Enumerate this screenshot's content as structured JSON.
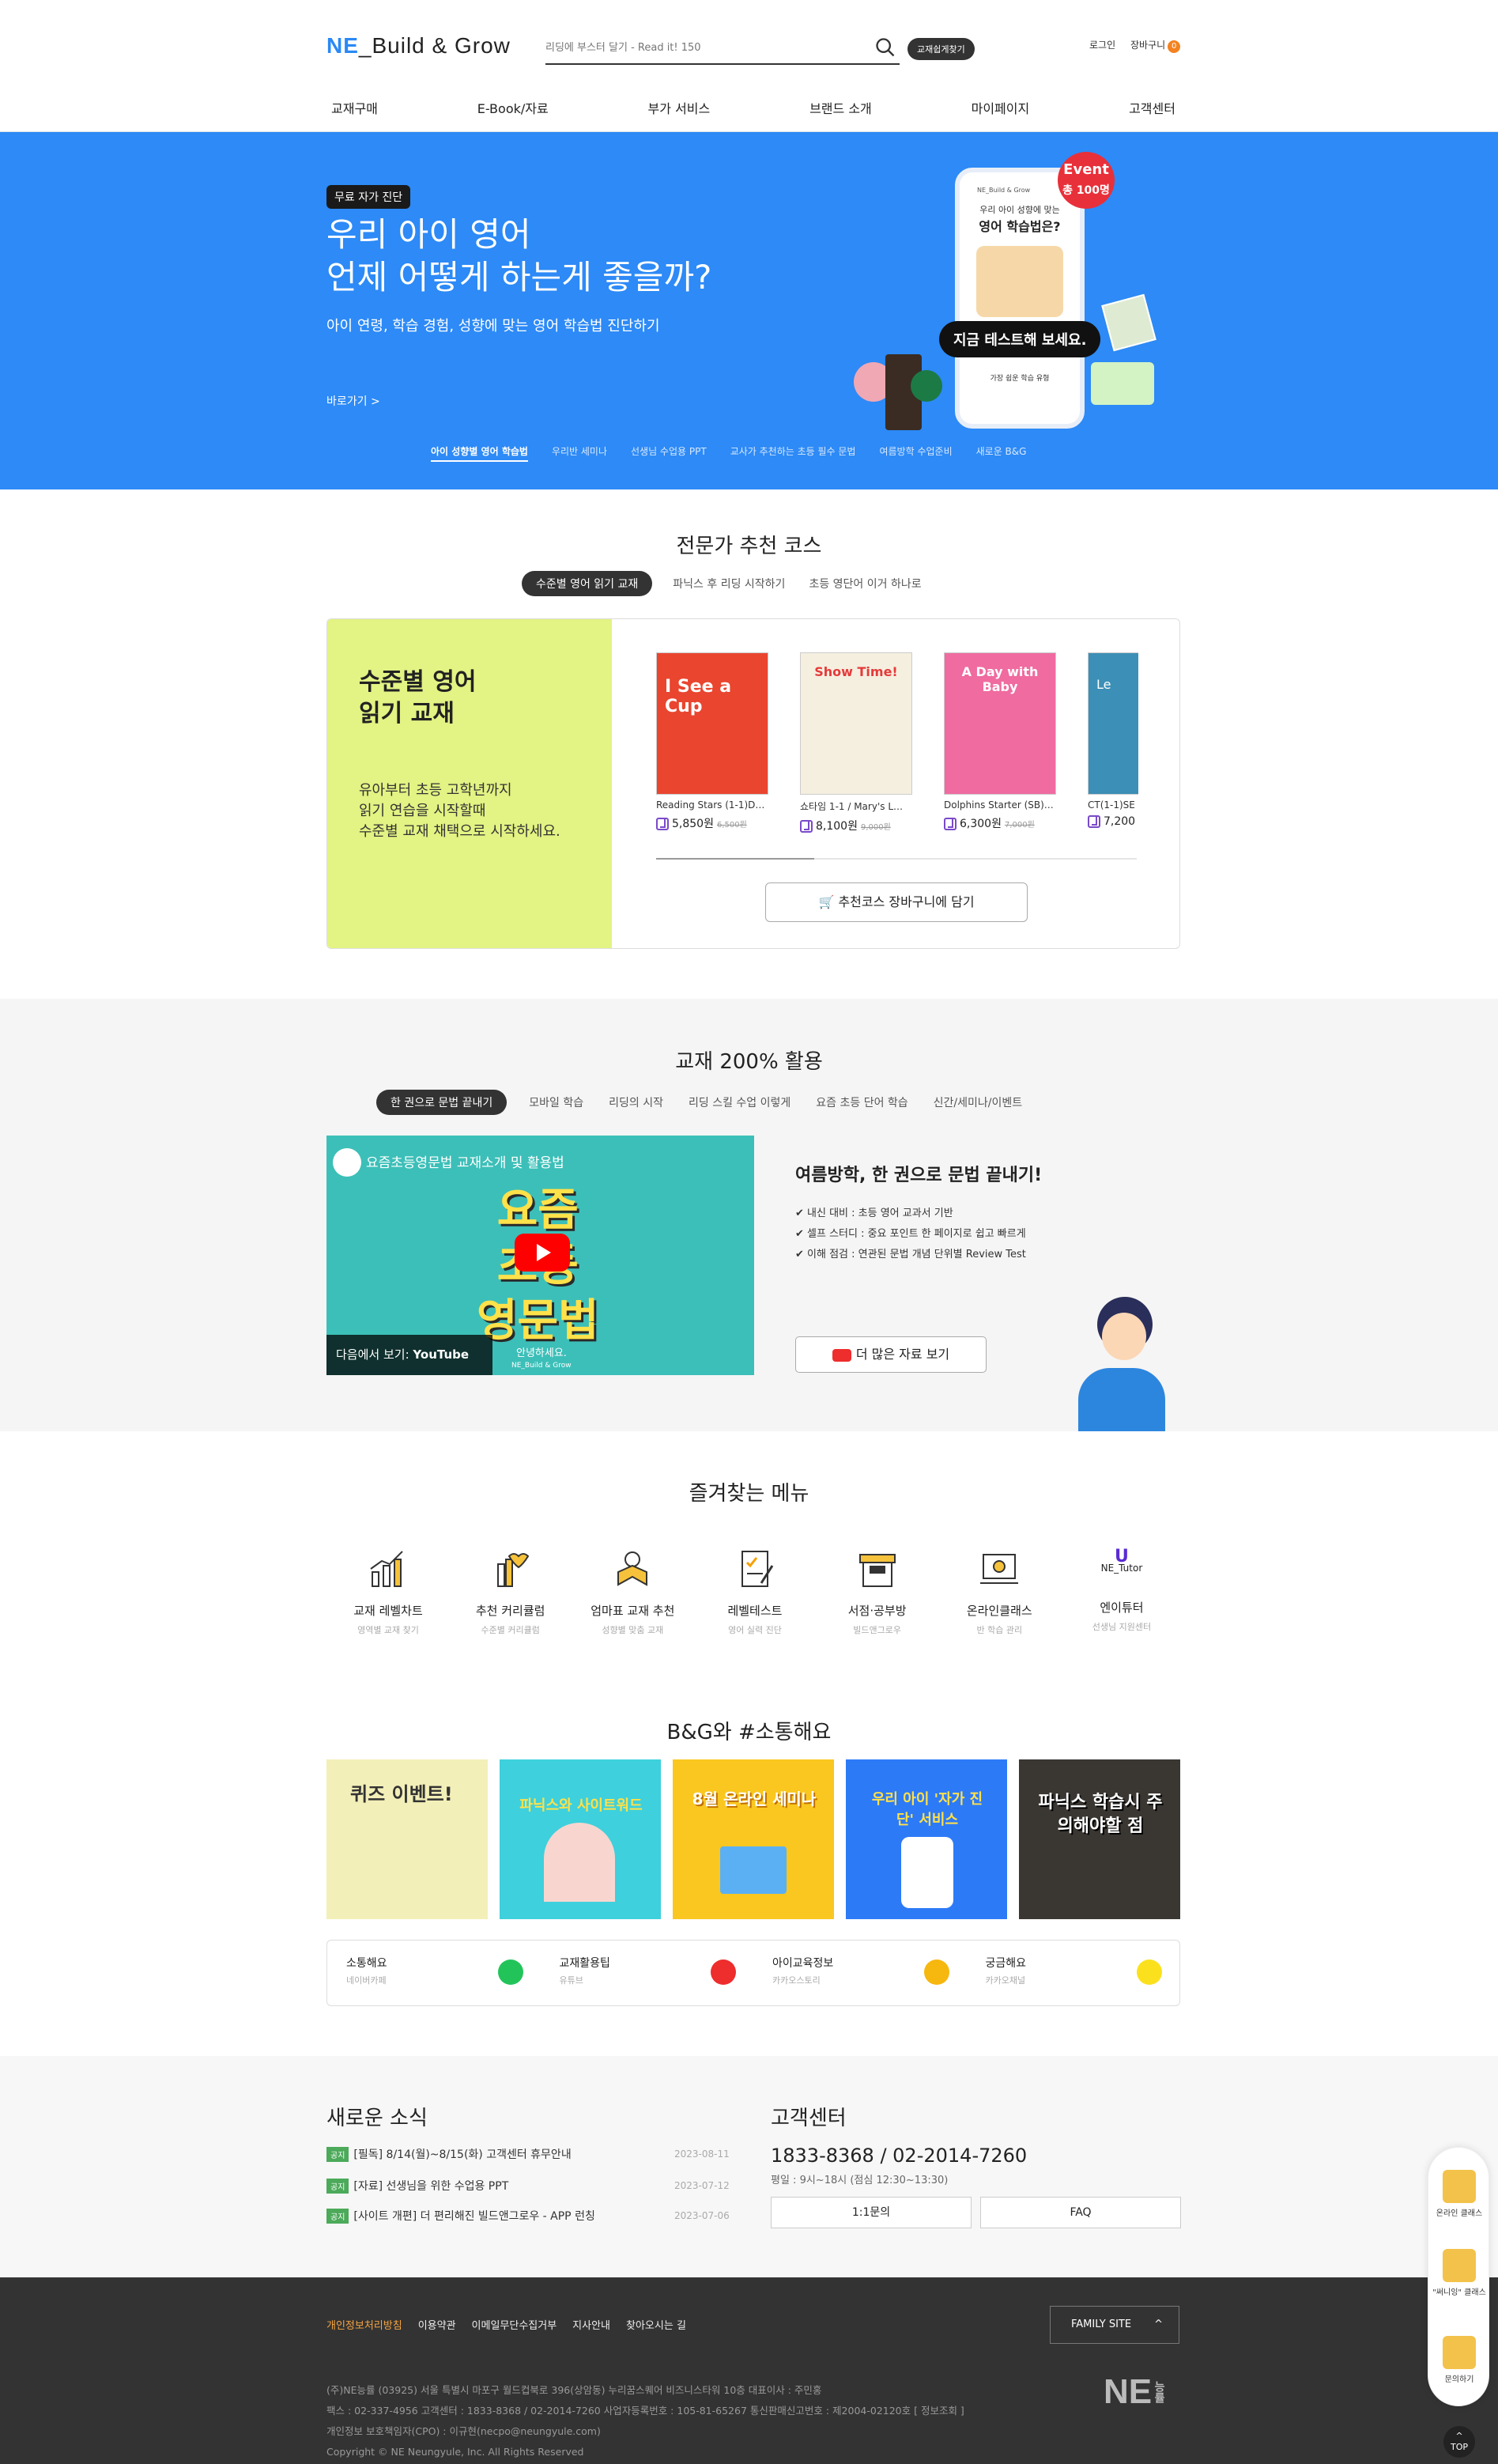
{
  "header": {
    "logo_ne": "NE",
    "logo_rest": "_Build & Grow",
    "search_placeholder": "리딩에 부스터 달기 - Read it! 150",
    "find_book": "교재쉽게찾기",
    "login": "로그인",
    "cart": "장바구니",
    "cart_count": "0",
    "gnb": [
      "교재구매",
      "E-Book/자료",
      "부가 서비스",
      "브랜드 소개",
      "마이페이지",
      "고객센터"
    ]
  },
  "hero": {
    "tag": "무료 자가 진단",
    "title1": "우리 아이 영어",
    "title2": "언제 어떻게 하는게 좋을까?",
    "sub": "아이 연령, 학습 경험, 성향에 맞는 영어 학습법 진단하기",
    "go": "바로가기  >",
    "phone_brand": "NE_Build & Grow",
    "phone_q1": "우리 아이 성향에 맞는",
    "phone_q2": "영어 학습법은?",
    "event1": "Event",
    "event2": "총 100명",
    "cta": "지금 테스트해 보세요.",
    "phone_opt": "가장 쉽운 학습 유형",
    "tabs": [
      "아이 성향별 영어 학습법",
      "우리반 세미나",
      "선생님 수업용 PPT",
      "교사가 추천하는 초등 필수 문법",
      "여름방학 수업준비",
      "새로운 B&G"
    ]
  },
  "expert": {
    "title": "전문가 추천 코스",
    "tabs": [
      "수준별 영어 읽기 교재",
      "파닉스 후 리딩 시작하기",
      "초등 영단어 이거 하나로"
    ],
    "course_title1": "수준별 영어",
    "course_title2": "읽기 교재",
    "course_desc1": "유아부터 초등 고학년까지",
    "course_desc2": "읽기 연습을 시작할때",
    "course_desc3": "수준별 교재 채택으로 시작하세요.",
    "books": [
      {
        "name": "Reading Stars (1-1)D…",
        "price": "5,850원",
        "orig": "6,500원",
        "cover": "I See a Cup",
        "color": "#e9452f"
      },
      {
        "name": "쇼타임 1-1 / Mary's L…",
        "price": "8,100원",
        "orig": "9,000원",
        "cover": "Show Time!",
        "color": "#e53a3a"
      },
      {
        "name": "Dolphins Starter (SB)…",
        "price": "6,300원",
        "orig": "7,000원",
        "cover": "A Day with Baby",
        "color": "#ef6ba0"
      },
      {
        "name": "CT(1-1)SE",
        "price": "7,200",
        "orig": "",
        "cover": "Le",
        "color": "#3c8fb6"
      }
    ],
    "cart_btn": "추천코스 장바구니에 담기"
  },
  "usage": {
    "title": "교재 200% 활용",
    "tabs": [
      "한 권으로 문법 끝내기",
      "모바일 학습",
      "리딩의 시작",
      "리딩 스킬 수업 이렇게",
      "요즘 초등 단어 학습",
      "신간/세미나/이벤트"
    ],
    "video_title": "요즘초등영문법 교재소개 및 활용법",
    "video_big1": "요즘",
    "video_big2": "초등",
    "video_big3": "영문법",
    "video_next": "다음에서 보기:",
    "video_yt": "YouTube",
    "video_hello": "안녕하세요.",
    "video_brand": "NE_Build & Grow",
    "heading": "여름방학, 한 권으로 문법 끝내기!",
    "points": [
      "✔ 내신 대비 : 초등 영어 교과서 기반",
      "✔ 셀프 스터디 : 중요 포인트 한 페이지로 쉽고 빠르게",
      "✔ 이해 점검 : 연관된 문법 개념 단위별 Review Test"
    ],
    "more": "더 많은 자료 보기"
  },
  "favorites": {
    "title": "즐겨찾는 메뉴",
    "items": [
      {
        "label": "교재 레벨차트",
        "sub": "영역별 교재 찾기",
        "icon": "chart-icon"
      },
      {
        "label": "추천 커리큘럼",
        "sub": "수준별 커리큘럼",
        "icon": "curriculum-icon"
      },
      {
        "label": "엄마표 교재 추천",
        "sub": "성향별 맞춤 교재",
        "icon": "reading-mom-icon"
      },
      {
        "label": "레벨테스트",
        "sub": "영어 실력 진단",
        "icon": "test-icon"
      },
      {
        "label": "서점·공부방",
        "sub": "빌드앤그로우",
        "icon": "store-icon"
      },
      {
        "label": "온라인클래스",
        "sub": "반 학습 관리",
        "icon": "online-class-icon"
      },
      {
        "label": "엔이튜터",
        "sub": "선생님 지원센터",
        "icon": "ne-tutor-icon"
      }
    ],
    "ne_tutor_logo": "NE_Tutor"
  },
  "sns": {
    "title": "B&G와 #소통해요",
    "cards": [
      {
        "text": "퀴즈 이벤트!",
        "bg": "#f3efb8"
      },
      {
        "text": "파닉스와 사이트워드",
        "bg": "#3ed0dc"
      },
      {
        "text": "8월 온라인 세미나",
        "bg": "#f9c720"
      },
      {
        "text": "우리 아이 '자가 진단' 서비스",
        "bg": "#2d7af6"
      },
      {
        "text": "파닉스 학습시 주의해야할 점",
        "bg": "#3a3632"
      }
    ],
    "channels": [
      {
        "title": "소통해요",
        "sub": "네이버카페",
        "color": "#22c45a"
      },
      {
        "title": "교재활용팁",
        "sub": "유튜브",
        "color": "#ee2d2d"
      },
      {
        "title": "아이교육정보",
        "sub": "카카오스토리",
        "color": "#f6b70f"
      },
      {
        "title": "궁금해요",
        "sub": "카카오채널",
        "color": "#fbe11d"
      }
    ]
  },
  "news": {
    "title": "새로운 소식",
    "badge": "공지",
    "items": [
      {
        "text": "[필독] 8/14(월)~8/15(화) 고객센터 휴무안내",
        "date": "2023-08-11"
      },
      {
        "text": "[자료] 선생님을 위한 수업용 PPT",
        "date": "2023-07-12"
      },
      {
        "text": "[사이트 개편] 더 편리해진 빌드앤그로우 - APP 런칭",
        "date": "2023-07-06"
      }
    ]
  },
  "cs": {
    "title": "고객센터",
    "tel": "1833-8368 / 02-2014-7260",
    "hours": "평일 : 9시~18시 (점심 12:30~13:30)",
    "btn1": "1:1문의",
    "btn2": "FAQ"
  },
  "footer": {
    "links": [
      "개인정보처리방침",
      "이용약관",
      "이메일무단수집거부",
      "지사안내",
      "찾아오시는 길"
    ],
    "family": "FAMILY SITE",
    "line1": "(주)NE능률 (03925) 서울 특별시 마포구 월드컵북로 396(상암동) 누리꿈스퀘어 비즈니스타워 10층    대표이사 : 주민홍",
    "line2": "팩스 : 02-337-4956    고객센터 : 1833-8368 / 02-2014-7260    사업자등록번호 : 105-81-65267    통신판매신고번호 : 제2004-02120호 [ 정보조회 ]",
    "line3": "개인정보 보호책임자(CPO) : 이규현(necpo@neungyule.com)",
    "copy": "Copyright © NE Neungyule, Inc. All Rights Reserved",
    "ne_logo": "NE",
    "ne_sub": "능률"
  },
  "quick": {
    "items": [
      "온라인 클래스",
      "\"써니잉\" 클래스",
      "문의하기"
    ],
    "top": "TOP"
  }
}
